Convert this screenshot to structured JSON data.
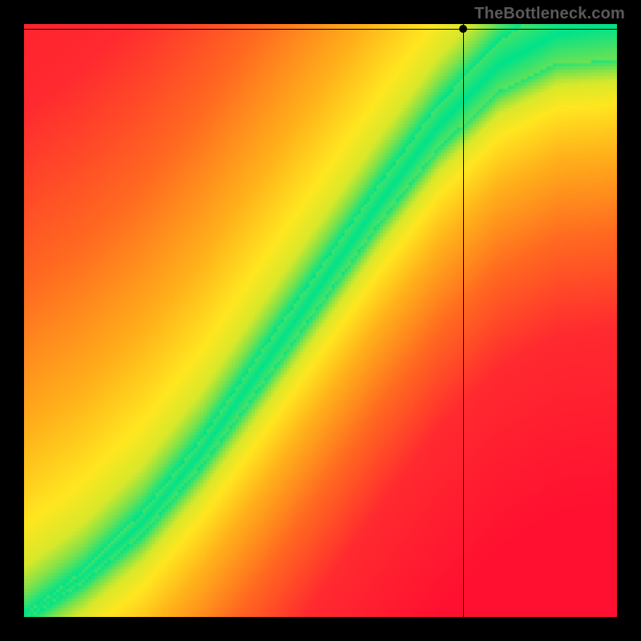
{
  "watermark": "TheBottleneck.com",
  "chart_data": {
    "type": "heatmap",
    "title": "",
    "xlabel": "",
    "ylabel": "",
    "xlim": [
      0,
      1
    ],
    "ylim": [
      0,
      1
    ],
    "marker": {
      "x": 0.74,
      "y": 0.992
    },
    "crosshair": {
      "x": 0.74,
      "y": 0.992
    },
    "optimal_band": {
      "description": "green optimal-performance band running from lower-left toward upper-right",
      "points": [
        {
          "x": 0.0,
          "center_y": 0.0,
          "half_width": 0.005
        },
        {
          "x": 0.1,
          "center_y": 0.07,
          "half_width": 0.01
        },
        {
          "x": 0.2,
          "center_y": 0.16,
          "half_width": 0.018
        },
        {
          "x": 0.3,
          "center_y": 0.28,
          "half_width": 0.022
        },
        {
          "x": 0.4,
          "center_y": 0.42,
          "half_width": 0.028
        },
        {
          "x": 0.5,
          "center_y": 0.56,
          "half_width": 0.03
        },
        {
          "x": 0.6,
          "center_y": 0.7,
          "half_width": 0.032
        },
        {
          "x": 0.7,
          "center_y": 0.83,
          "half_width": 0.036
        },
        {
          "x": 0.8,
          "center_y": 0.93,
          "half_width": 0.042
        },
        {
          "x": 0.9,
          "center_y": 0.985,
          "half_width": 0.05
        },
        {
          "x": 1.0,
          "center_y": 1.0,
          "half_width": 0.06
        }
      ]
    },
    "color_scale": {
      "stops": [
        {
          "d": 0.0,
          "color": "#00e28a"
        },
        {
          "d": 0.04,
          "color": "#7fe24a"
        },
        {
          "d": 0.08,
          "color": "#d8e82a"
        },
        {
          "d": 0.15,
          "color": "#ffe620"
        },
        {
          "d": 0.3,
          "color": "#ffb21a"
        },
        {
          "d": 0.55,
          "color": "#ff6a20"
        },
        {
          "d": 0.85,
          "color": "#ff2a2f"
        },
        {
          "d": 1.4,
          "color": "#ff1030"
        }
      ]
    },
    "grid_resolution": 185
  }
}
